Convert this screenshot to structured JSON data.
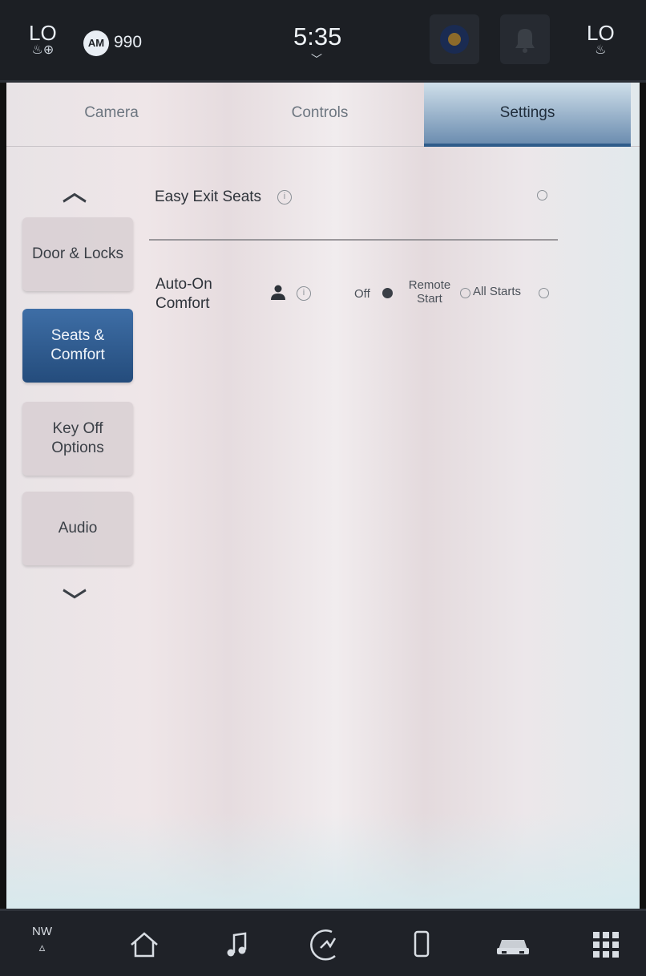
{
  "status_bar": {
    "left_temp": "LO",
    "right_temp": "LO",
    "radio_band": "AM",
    "radio_frequency": "990",
    "clock": "5:35"
  },
  "tabs": [
    {
      "label": "Camera",
      "active": false
    },
    {
      "label": "Controls",
      "active": false
    },
    {
      "label": "Settings",
      "active": true
    }
  ],
  "sidebar": {
    "items": [
      {
        "label": "Door & Locks",
        "active": false
      },
      {
        "label": "Seats & Comfort",
        "active": true
      },
      {
        "label": "Key Off Options",
        "active": false
      },
      {
        "label": "Audio",
        "active": false
      }
    ]
  },
  "settings": {
    "easy_exit": {
      "label": "Easy Exit Seats",
      "enabled": false
    },
    "auto_on": {
      "label": "Auto-On Comfort",
      "options": [
        "Off",
        "Remote Start",
        "All Starts"
      ],
      "selected": "Off"
    }
  },
  "bottom_nav": {
    "compass": "NW",
    "icons": [
      "home-icon",
      "music-icon",
      "driver-assist-icon",
      "phone-icon",
      "vehicle-icon",
      "apps-grid-icon"
    ]
  },
  "colors": {
    "accent": "#2f5c8a",
    "active_button": "#244c7c"
  }
}
